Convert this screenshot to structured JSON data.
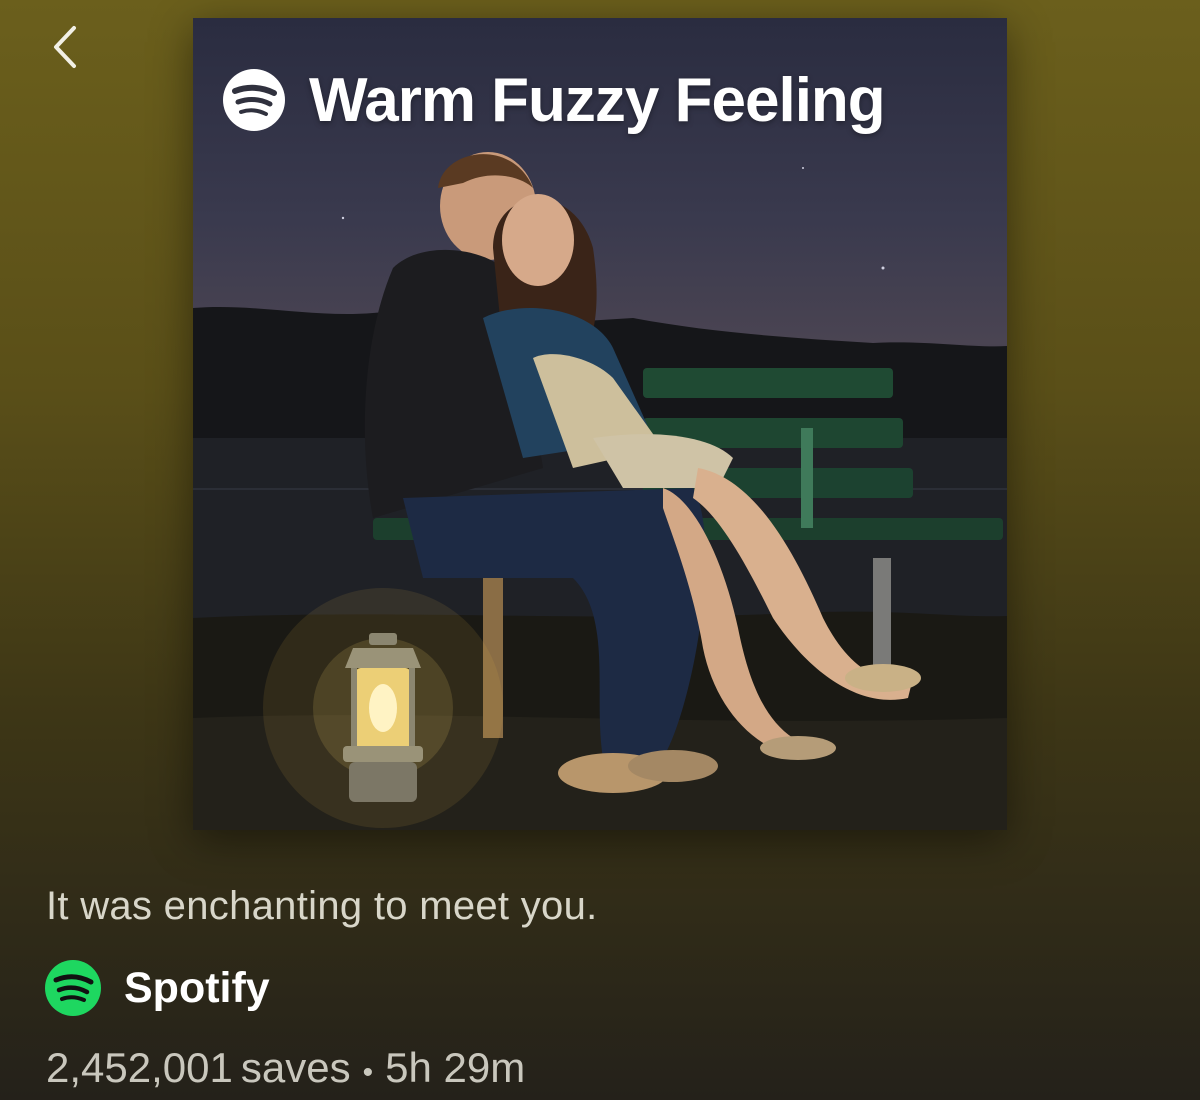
{
  "header": {
    "back_icon": "chevron-left-icon"
  },
  "cover": {
    "title": "Warm Fuzzy Feeling",
    "logo_icon": "spotify-logo-icon"
  },
  "playlist": {
    "description": "It was enchanting to meet you.",
    "owner": {
      "name": "Spotify",
      "avatar_icon": "spotify-logo-icon",
      "avatar_color": "#1ed760"
    },
    "saves_count": "2,452,001",
    "saves_label": "saves",
    "separator": "•",
    "duration": "5h 29m"
  }
}
